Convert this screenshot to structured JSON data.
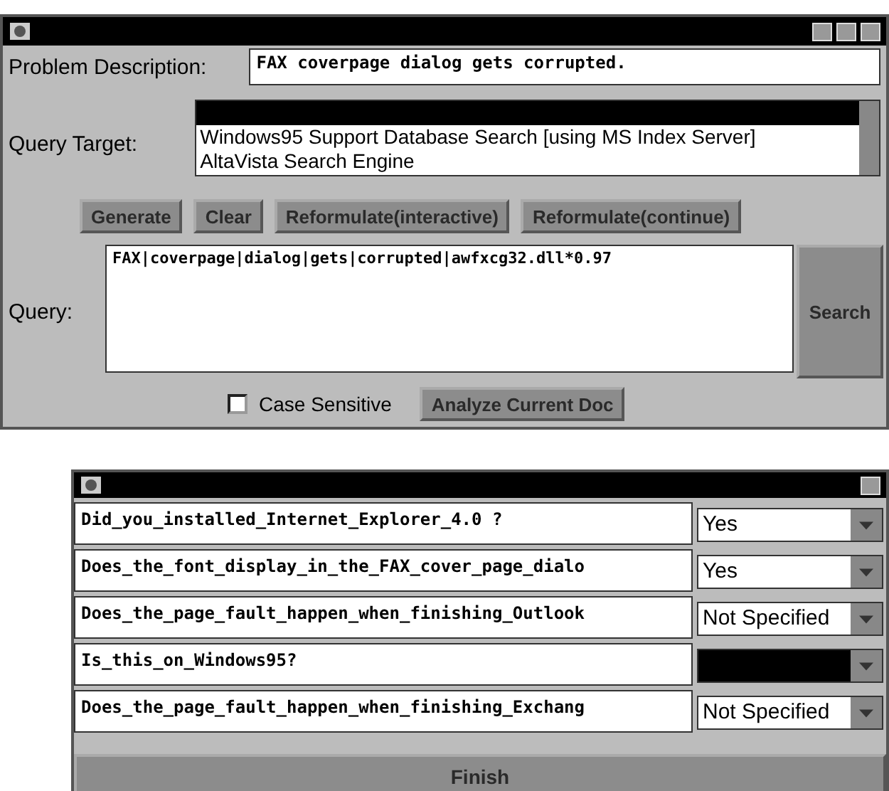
{
  "main_window": {
    "problem_description": {
      "label": "Problem Description:",
      "value": "FAX coverpage dialog gets corrupted."
    },
    "query_target": {
      "label": "Query Target:",
      "items": [
        {
          "selected": true
        },
        {
          "label": "Windows95 Support Database Search [using MS Index Server]",
          "selected": false
        },
        {
          "label": "AltaVista Search Engine",
          "selected": false
        }
      ]
    },
    "buttons": [
      "Generate",
      "Clear",
      "Reformulate(interactive)",
      "Reformulate(continue)"
    ],
    "query": {
      "label": "Query:",
      "value": "FAX|coverpage|dialog|gets|corrupted|awfxcg32.dll*0.97",
      "search_button": "Search"
    },
    "case_sensitive": {
      "label": "Case Sensitive",
      "checked": false
    },
    "analyze_button": "Analyze Current Doc"
  },
  "dialog": {
    "questions": [
      {
        "text": "Did_you_installed_Internet_Explorer_4.0 ?",
        "answer": "Yes",
        "focused": false
      },
      {
        "text": "Does_the_font_display_in_the_FAX_cover_page_dialo",
        "answer": "Yes",
        "focused": false
      },
      {
        "text": "Does_the_page_fault_happen_when_finishing_Outlook",
        "answer": "Not Specified",
        "focused": false
      },
      {
        "text": "Is_this_on_Windows95?",
        "focused": true
      },
      {
        "text": "Does_the_page_fault_happen_when_finishing_Exchang",
        "answer": "Not Specified",
        "focused": false
      }
    ],
    "finish_button": "Finish"
  }
}
